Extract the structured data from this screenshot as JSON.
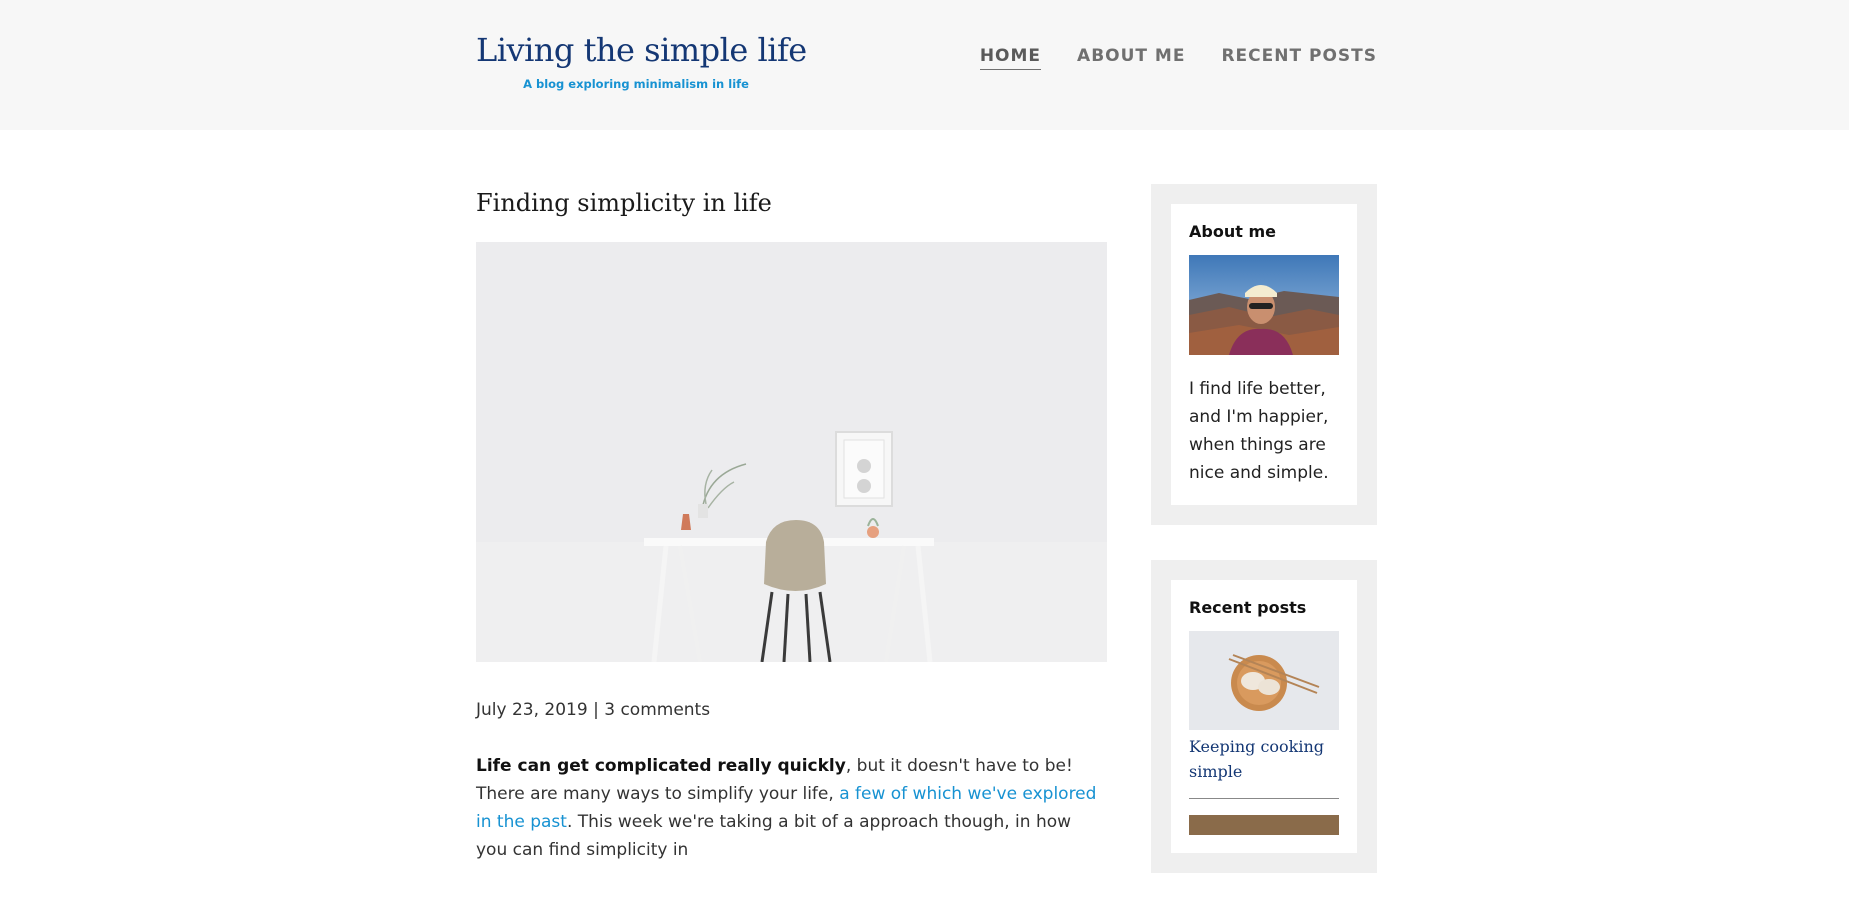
{
  "header": {
    "title": "Living the simple life",
    "subtitle": "A blog exploring minimalism in life",
    "nav": [
      {
        "label": "HOME",
        "active": true
      },
      {
        "label": "ABOUT ME",
        "active": false
      },
      {
        "label": "RECENT POSTS",
        "active": false
      }
    ]
  },
  "post": {
    "title": "Finding simplicity in life",
    "image_alt": "minimalist white desk with chair, plants and frame",
    "date": "July 23, 2019",
    "separator": " | ",
    "comments": "3 comments",
    "intro_bold": "Life can get complicated really quickly",
    "intro_rest_1": ", but it doesn't have to be! There are many ways to simplify your life, ",
    "intro_link": "a few of which we've explored in the past",
    "intro_rest_2": ". This week we're taking a bit of a approach though, in how you can find simplicity in"
  },
  "sidebar": {
    "about": {
      "title": "About me",
      "text": "I find life better, and I'm happier, when things are nice and simple."
    },
    "recent": {
      "title": "Recent posts",
      "items": [
        {
          "label": "Keeping cooking simple"
        }
      ]
    }
  },
  "colors": {
    "brand": "#143774",
    "accent": "#1792d2",
    "header_bg": "#f7f7f7",
    "widget_bg": "#efefef"
  }
}
